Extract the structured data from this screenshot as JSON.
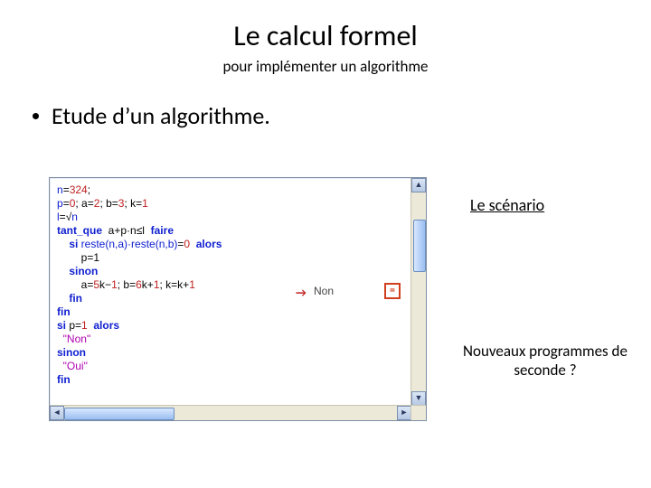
{
  "title": "Le calcul formel",
  "subtitle": "pour implémenter un algorithme",
  "bullet": "Etude d’un algorithme.",
  "scenario_link": "Le scénario",
  "note": "Nouveaux programmes de seconde ?",
  "result": {
    "arrow": "→",
    "text": "Non",
    "icon": "="
  },
  "code": {
    "l1a": "n",
    "l1b": "=",
    "l1c": "324",
    "l1d": ";",
    "l2a": "p",
    "l2b": "=",
    "l2c": "0",
    "l2d": "; a",
    "l2e": "=",
    "l2f": "2",
    "l2g": "; b",
    "l2h": "=",
    "l2i": "3",
    "l2j": "; k",
    "l2k": "=",
    "l2l": "1",
    "l3a": "l",
    "l3b": "=",
    "l3c": "√",
    "l3d": "n",
    "l4a": "tant_que",
    "l4b": "  a+p·n≤l  ",
    "l4c": "faire",
    "l5a": "    si",
    "l5b": " reste(n,a)·reste(n,b)",
    "l5c": "=",
    "l5d": "0",
    "l5e": "  alors",
    "l6": "        p=1",
    "l7": "    sinon",
    "l8a": "        a=",
    "l8b": "5",
    "l8c": "k−",
    "l8d": "1",
    "l8e": "; b=",
    "l8f": "6",
    "l8g": "k+",
    "l8h": "1",
    "l8i": "; k=k+",
    "l8j": "1",
    "l9": "    fin",
    "l10": "fin",
    "l11a": "si",
    "l11b": " p=",
    "l11c": "1",
    "l11d": "  alors",
    "l12": "  \"Non\"",
    "l13": "sinon",
    "l14": "  \"Oui\"",
    "l15": "fin"
  }
}
